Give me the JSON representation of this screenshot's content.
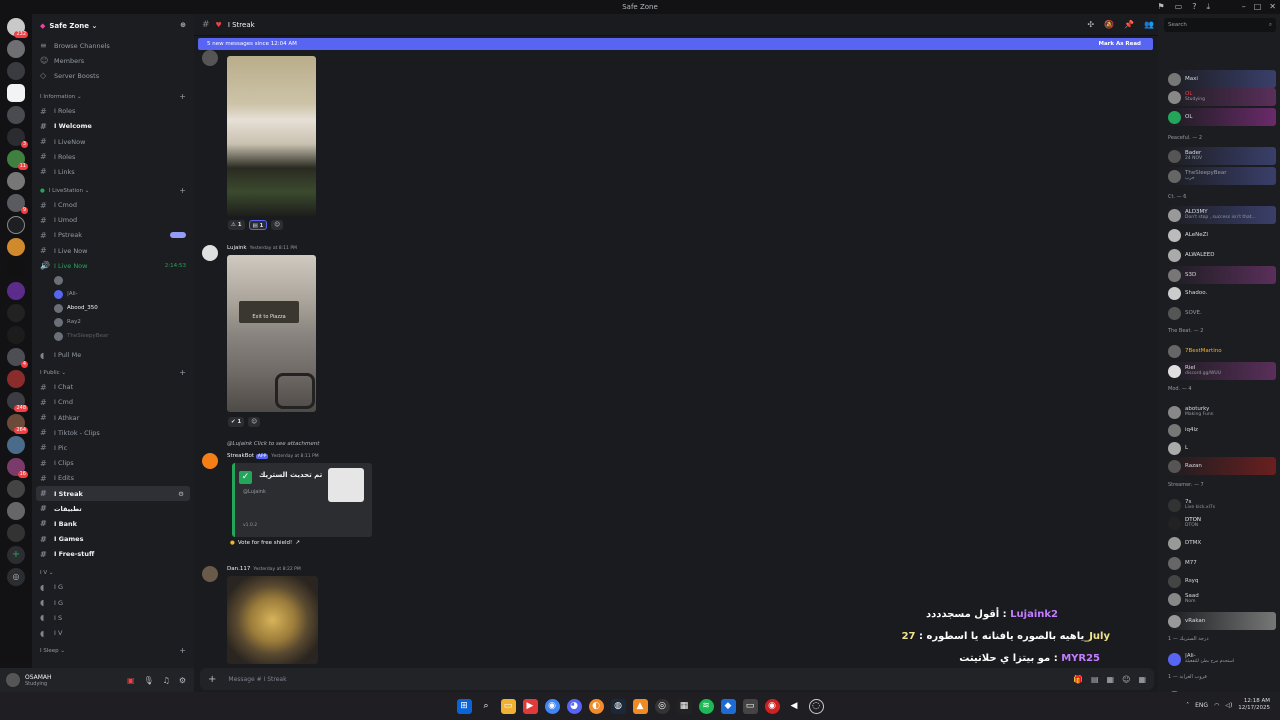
{
  "window": {
    "title": "Safe Zone"
  },
  "server": {
    "name": "Safe Zone ⌄"
  },
  "top_links": [
    "Browse Channels",
    "Members",
    "Server Boosts"
  ],
  "categories": {
    "information": "I Information ⌄",
    "livestation": "I LiveStation ⌄",
    "public": "I Public ⌄",
    "v": "I V ⌄",
    "sleep": "I Sleep ⌄"
  },
  "info_channels": [
    "I Roles",
    "I Welcome",
    "I LiveNow",
    "I Roles",
    "I Links"
  ],
  "live_channels": [
    "I Cmod",
    "I Umod",
    "I Pstreak",
    "I Live Now",
    "I Live Now"
  ],
  "live_timer": "2:14:53",
  "voice_users": [
    "",
    "|Ali-",
    "Abood_350",
    "Ray2",
    "TheSleepyBear"
  ],
  "pull_me": "I Pull Me",
  "public_channels": [
    "I Chat",
    "I Cmd",
    "I Athkar",
    "I Tiktok - Clips",
    "I Pic",
    "I Clips",
    "I Edits",
    "I Streak",
    "تطبيقات",
    "I Bank",
    "I Games",
    "I Free-stuff"
  ],
  "v_channels": [
    "I G",
    "I G",
    "I S",
    "I V"
  ],
  "user": {
    "name": "OSAMAH",
    "status": "Studying"
  },
  "channel": {
    "name": "I Streak"
  },
  "new_messages": {
    "text": "5 new messages since 12:04 AM",
    "action": "Mark As Read"
  },
  "messages": {
    "m1": {
      "reactions": [
        "1",
        "1"
      ]
    },
    "m2": {
      "author": "Lujaink",
      "time": "Yesterday at 8:11 PM",
      "sign_text": "Exit to Piazza",
      "reactions": [
        "1"
      ]
    },
    "m3": {
      "reply": "@Lujaink Click to see attachment",
      "author": "StreakBot",
      "badge": "APP",
      "time": "Yesterday at 8:11 PM",
      "embed_title": "تم تحديث الستريك",
      "embed_mention": "@Lujaink",
      "embed_version": "v1.0.2",
      "vote": "Vote for free shield!"
    },
    "m4": {
      "author": "Dan.117",
      "time": "Yesterday at 8:22 PM"
    }
  },
  "overlay": {
    "line1_text": "أقول مسجدددد : ",
    "line1_user": "Lujaink2",
    "line2_text": "ياهيه بالصوره يافنانه يا اسطوره : ",
    "line2_user": "27_July",
    "line3_text": "مو بيتزا ي حلاتيتت : ",
    "line3_user": "MYR25"
  },
  "composer": {
    "placeholder": "Message # I Streak"
  },
  "members": {
    "search": "Search",
    "groups": [
      "Peaceful. — 2",
      "Ct. — 6",
      "The Beat. — 2",
      "Mod. — 4",
      "Streamer. — 7",
      "درجة الستريك — 1",
      "قروب الغرابة — 1"
    ],
    "list": [
      {
        "name": "Maxi",
        "status": ""
      },
      {
        "name": "OL",
        "status": "Studying"
      },
      {
        "name": "OL",
        "status": ""
      },
      {
        "name": "Bader",
        "status": "24 NOV"
      },
      {
        "name": "TheSleepyBear",
        "status": "حرب"
      },
      {
        "name": "ALD3MY",
        "status": "Don't stop , success isn't that..."
      },
      {
        "name": "ALeNeZI",
        "status": ""
      },
      {
        "name": "ALWALEED",
        "status": ""
      },
      {
        "name": "S3D",
        "status": ""
      },
      {
        "name": "Shadoo.",
        "status": ""
      },
      {
        "name": "SOVE.",
        "status": ""
      },
      {
        "name": "7BestMartino",
        "status": ""
      },
      {
        "name": "Riel",
        "status": "discord.gg/WUU"
      },
      {
        "name": "aboturky",
        "status": "Making Funn"
      },
      {
        "name": "iq4lz",
        "status": ""
      },
      {
        "name": "L",
        "status": ""
      },
      {
        "name": "Razan",
        "status": ""
      },
      {
        "name": "7s",
        "status": "Live kick.xl7s"
      },
      {
        "name": "DTON",
        "status": "DTON"
      },
      {
        "name": "DTMX",
        "status": ""
      },
      {
        "name": "M77",
        "status": ""
      },
      {
        "name": "Rsyq",
        "status": ""
      },
      {
        "name": "Saad",
        "status": "Nom"
      },
      {
        "name": "vRakan",
        "status": ""
      },
      {
        "name": "|Ali-",
        "status": "استحدم مرح بطئ للتفعيلة"
      },
      {
        "name": "Ray2",
        "status": ""
      }
    ]
  },
  "tray": {
    "lang": "ENG",
    "time": "12:18 AM",
    "date": "12/17/2025"
  },
  "colors": {
    "accent": "#5865f2",
    "online": "#23a55a",
    "dnd": "#f23f43"
  }
}
